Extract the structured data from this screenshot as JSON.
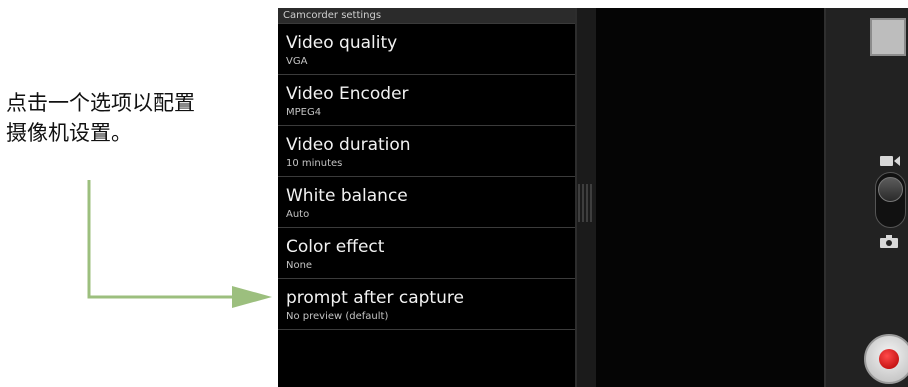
{
  "instruction": {
    "line1": "点击一个选项以配置",
    "line2": "摄像机设置。"
  },
  "panel": {
    "header": "Camcorder settings",
    "items": [
      {
        "title": "Video quality",
        "value": "VGA"
      },
      {
        "title": "Video Encoder",
        "value": "MPEG4"
      },
      {
        "title": "Video duration",
        "value": "10 minutes"
      },
      {
        "title": "White balance",
        "value": "Auto"
      },
      {
        "title": "Color effect",
        "value": "None"
      },
      {
        "title": "prompt after capture",
        "value": "No preview (default)"
      }
    ]
  },
  "controls": {
    "mode": "video",
    "icons": [
      "video-camera-icon",
      "photo-camera-icon",
      "record-icon"
    ]
  },
  "colors": {
    "arrow": "#9cbf7e",
    "record": "#d30000",
    "panel_bg": "#000000"
  }
}
